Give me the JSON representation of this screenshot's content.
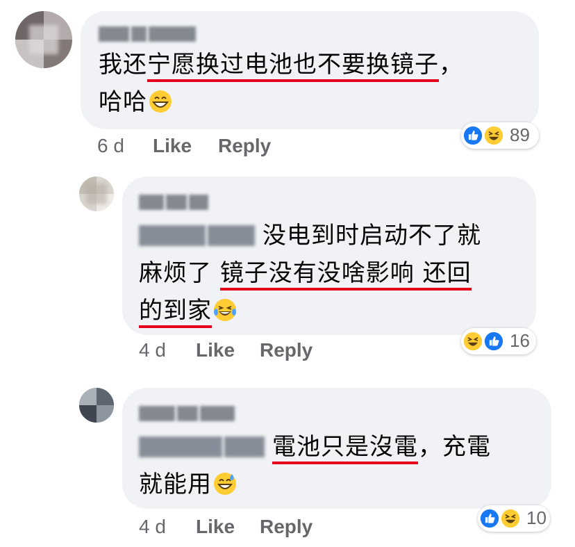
{
  "comments": [
    {
      "body_parts": [
        "我还",
        "宁愿换过电池也不要换镜子",
        "，",
        "哈哈"
      ],
      "time": "6 d",
      "like": "Like",
      "reply": "Reply",
      "reaction_count": "89"
    },
    {
      "body_parts": [
        "没电到时启动不了就",
        "麻烦了 ",
        "镜子没有没啥影响 还回",
        "的到家"
      ],
      "time": "4 d",
      "like": "Like",
      "reply": "Reply",
      "reaction_count": "16"
    },
    {
      "body_parts": [
        "電池只是沒電",
        "，充電",
        "就能用"
      ],
      "time": "4 d",
      "like": "Like",
      "reply": "Reply",
      "reaction_count": "10"
    }
  ],
  "icons": [
    "blurred-avatar",
    "like-reaction-icon",
    "haha-reaction-icon",
    "grinning-emoji",
    "tears-of-joy-emoji",
    "sweat-smile-emoji"
  ],
  "colors": {
    "bubble": "#f0f2f5",
    "underline": "#e4001b",
    "meta_text": "#65676b",
    "like_blue": "#1877f2",
    "emoji_yellow": "#ffcc33"
  }
}
